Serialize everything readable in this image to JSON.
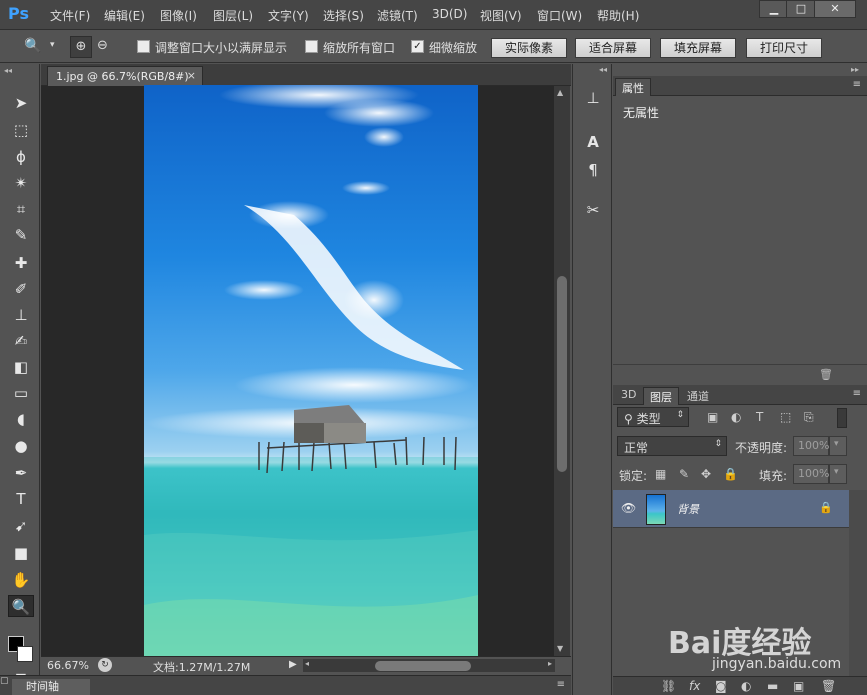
{
  "app": {
    "logo": "Ps"
  },
  "menu": [
    "文件(F)",
    "编辑(E)",
    "图像(I)",
    "图层(L)",
    "文字(Y)",
    "选择(S)",
    "滤镜(T)",
    "3D(D)",
    "视图(V)",
    "窗口(W)",
    "帮助(H)"
  ],
  "window_controls": {
    "minimize": "▁",
    "maximize": "□",
    "close": "✕"
  },
  "options": {
    "resize_window": {
      "label": "调整窗口大小以满屏显示",
      "checked": false
    },
    "zoom_all": {
      "label": "缩放所有窗口",
      "checked": false
    },
    "scrubby_zoom": {
      "label": "细微缩放",
      "checked": true
    },
    "buttons": [
      "实际像素",
      "适合屏幕",
      "填充屏幕",
      "打印尺寸"
    ]
  },
  "document": {
    "tab_title": "1.jpg @ 66.7%(RGB/8#)",
    "tab_close": "×"
  },
  "status": {
    "zoom": "66.67%",
    "doc_info": "文档:1.27M/1.27M"
  },
  "timeline": {
    "label": "时间轴"
  },
  "properties": {
    "tab": "属性",
    "empty_text": "无属性"
  },
  "layers_panel": {
    "tabs": [
      "3D",
      "图层",
      "通道"
    ],
    "active_tab": "图层",
    "filter_label": "类型",
    "blend_mode": "正常",
    "opacity_label": "不透明度:",
    "opacity_value": "100%",
    "lock_label": "锁定:",
    "fill_label": "填充:",
    "fill_value": "100%",
    "layers": [
      {
        "name": "背景",
        "visible": true,
        "locked": true
      }
    ]
  },
  "watermark": {
    "main": "Bai度经验",
    "sub": "jingyan.baidu.com"
  },
  "colors": {
    "accent": "#3fa2ff",
    "selected_layer": "#5b6a84"
  }
}
